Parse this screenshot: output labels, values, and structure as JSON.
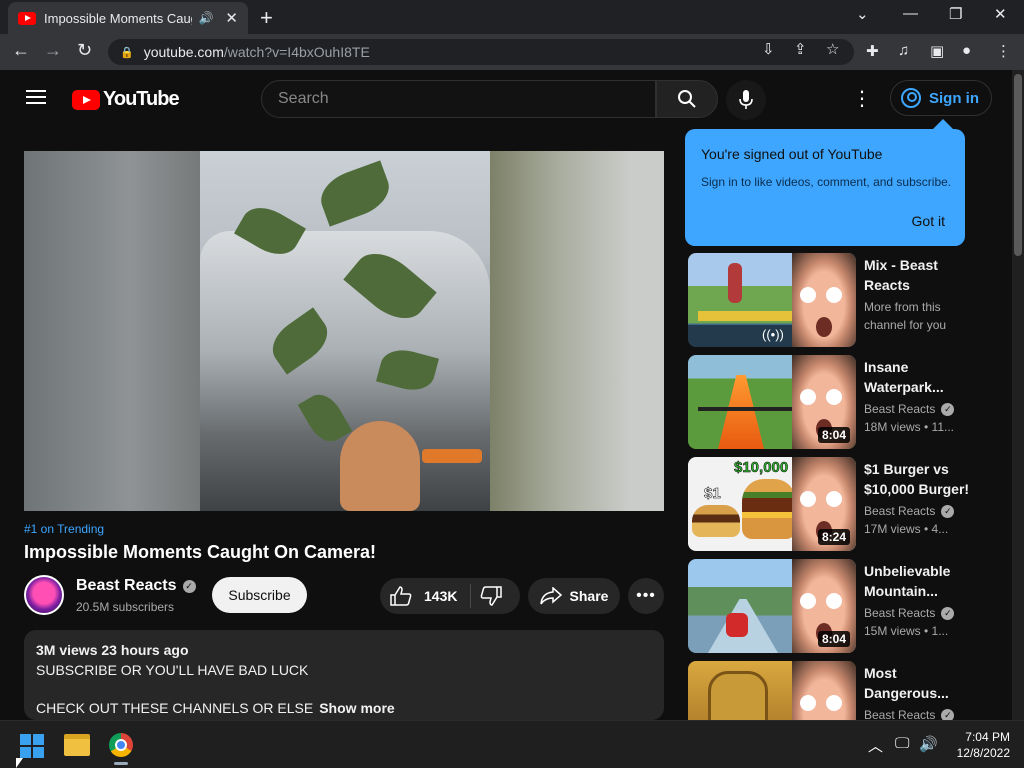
{
  "browser": {
    "tab_title": "Impossible Moments Caught On Camera! - YouTube",
    "url_host": "youtube.com",
    "url_path": "/watch?v=I4bxOuhI8TE"
  },
  "header": {
    "logo_text": "YouTube",
    "search_placeholder": "Search",
    "signin_label": "Sign in"
  },
  "tooltip": {
    "title": "You're signed out of YouTube",
    "body": "Sign in to like videos, comment, and subscribe.",
    "button": "Got it"
  },
  "video": {
    "trending": "#1 on Trending",
    "title": "Impossible Moments Caught On Camera!",
    "channel": "Beast Reacts",
    "subscribers": "20.5M subscribers",
    "subscribe_label": "Subscribe",
    "likes": "143K",
    "share_label": "Share"
  },
  "description": {
    "meta": "3M views  23 hours ago",
    "line1": "SUBSCRIBE OR YOU'LL HAVE BAD LUCK",
    "line2": "CHECK OUT THESE CHANNELS OR ELSE",
    "show_more": "Show more"
  },
  "recommendations": [
    {
      "title": "Mix - Beast\nReacts",
      "channel": "More from this",
      "stats": "channel for you",
      "duration": ""
    },
    {
      "title": "Insane\nWaterpark...",
      "channel": "Beast Reacts",
      "stats": "18M views  • 11...",
      "duration": "8:04"
    },
    {
      "title": "$1 Burger vs\n$10,000 Burger!",
      "channel": "Beast Reacts",
      "stats": "17M views  • 4...",
      "duration": "8:24"
    },
    {
      "title": "Unbelievable\nMountain...",
      "channel": "Beast Reacts",
      "stats": "15M views  • 1...",
      "duration": "8:04"
    },
    {
      "title": "Most\nDangerous...",
      "channel": "Beast Reacts",
      "stats": "",
      "duration": ""
    }
  ],
  "thumb_text": {
    "burger_big": "$10,000",
    "burger_small": "$1"
  },
  "taskbar": {
    "time": "7:04 PM",
    "date": "12/8/2022"
  }
}
